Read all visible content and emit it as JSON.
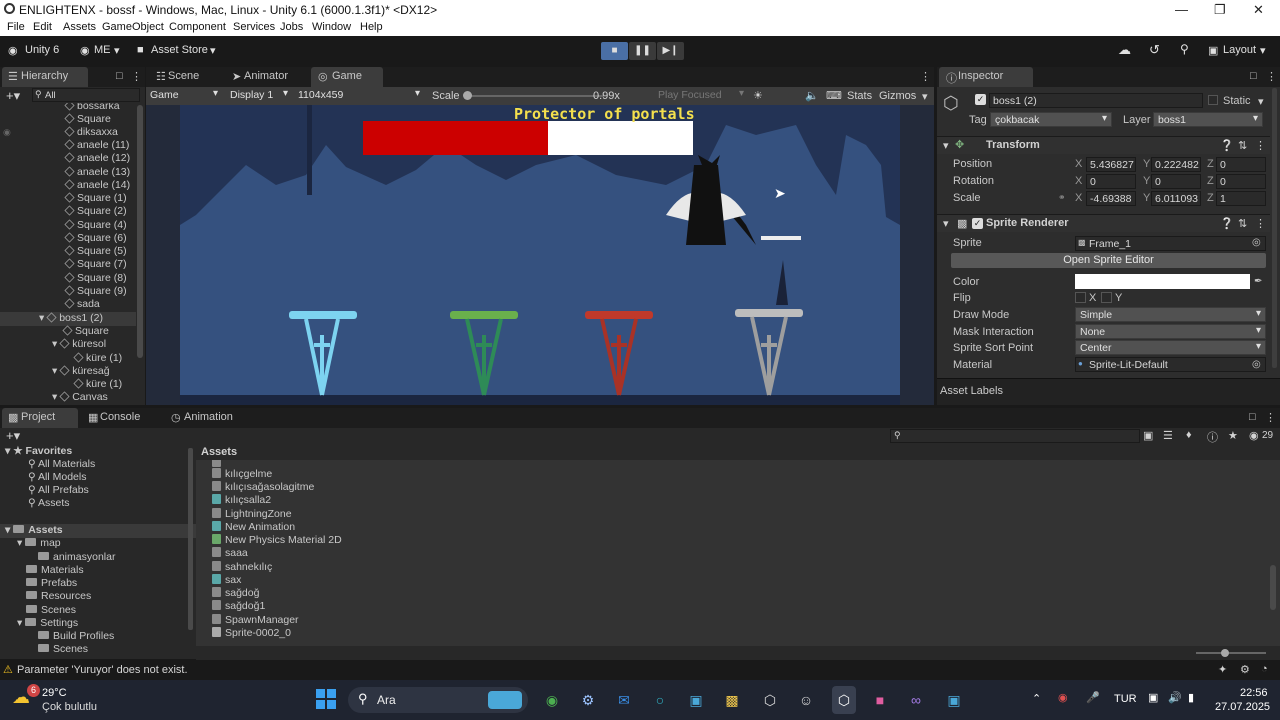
{
  "window": {
    "title": "ENLIGHTENX - bossf - Windows, Mac, Linux - Unity 6.1 (6000.1.3f1)* <DX12>"
  },
  "menu": [
    "File",
    "Edit",
    "Assets",
    "GameObject",
    "Component",
    "Services",
    "Jobs",
    "Window",
    "Help"
  ],
  "toolbar": {
    "unity": "Unity 6",
    "account": "ME",
    "store": "Asset Store",
    "layout": "Layout"
  },
  "hierarchy": {
    "tab": "Hierarchy",
    "search_placeholder": "All",
    "items": [
      "bossarka",
      "Square",
      "diksaxxa",
      "anaele (11)",
      "anaele (12)",
      "anaele (13)",
      "anaele (14)",
      "Square (1)",
      "Square (2)",
      "Square (4)",
      "Square (6)",
      "Square (5)",
      "Square (7)",
      "Square (8)",
      "Square (9)",
      "sada",
      "boss1 (2)",
      "Square",
      "küresol",
      "küre (1)",
      "küresağ",
      "küre (1)",
      "Canvas"
    ]
  },
  "game": {
    "tabs": [
      "Scene",
      "Animator",
      "Game"
    ],
    "mode": "Game",
    "display": "Display 1",
    "resolution": "1104x459",
    "scale_label": "Scale",
    "scale_value": "0.99x",
    "play_focused": "Play Focused",
    "stats": "Stats",
    "gizmos": "Gizmos",
    "boss_title": "Protector of portals",
    "boss_health": 0.56
  },
  "inspector": {
    "tab": "Inspector",
    "object_name": "boss1 (2)",
    "static": "Static",
    "tag_label": "Tag",
    "tag": "çokbacak",
    "layer_label": "Layer",
    "layer": "boss1",
    "transform": {
      "title": "Transform",
      "position_label": "Position",
      "rotation_label": "Rotation",
      "scale_label": "Scale",
      "position": [
        "5.436827",
        "0.222482",
        "0"
      ],
      "rotation": [
        "0",
        "0",
        "0"
      ],
      "scale": [
        "-4.69388",
        "6.011093",
        "1"
      ]
    },
    "sprite_renderer": {
      "title": "Sprite Renderer",
      "sprite_label": "Sprite",
      "sprite": "Frame_1",
      "open_editor": "Open Sprite Editor",
      "color_label": "Color",
      "flip_label": "Flip",
      "flip_x": "X",
      "flip_y": "Y",
      "draw_mode_label": "Draw Mode",
      "draw_mode": "Simple",
      "mask_label": "Mask Interaction",
      "mask": "None",
      "sort_point_label": "Sprite Sort Point",
      "sort_point": "Center",
      "material_label": "Material",
      "material": "Sprite-Lit-Default"
    },
    "asset_labels": "Asset Labels"
  },
  "bottom": {
    "tabs": [
      "Project",
      "Console",
      "Animation"
    ],
    "count": "29",
    "favorites_label": "Favorites",
    "favorites": [
      "All Materials",
      "All Models",
      "All Prefabs",
      "Assets"
    ],
    "assets_label": "Assets",
    "folders": [
      "map",
      "animasyonlar",
      "Materials",
      "Prefabs",
      "Resources",
      "Scenes",
      "Settings",
      "Build Profiles",
      "Scenes"
    ],
    "path": "Assets",
    "files": [
      "kılıçgelme",
      "kılıçısağasolagitme",
      "kılıçsalla2",
      "LightningZone",
      "New Animation",
      "New Physics Material 2D",
      "saaa",
      "sahnekılıç",
      "sax",
      "sağdoğ",
      "sağdoğ1",
      "SpawnManager",
      "Sprite-0002_0"
    ]
  },
  "status": {
    "warning": "Parameter 'Yuruyor' does not exist."
  },
  "taskbar": {
    "temp": "29°C",
    "weather": "Çok bulutlu",
    "badge": "6",
    "search": "Ara",
    "lang": "TUR",
    "time": "22:56",
    "date": "27.07.2025"
  }
}
